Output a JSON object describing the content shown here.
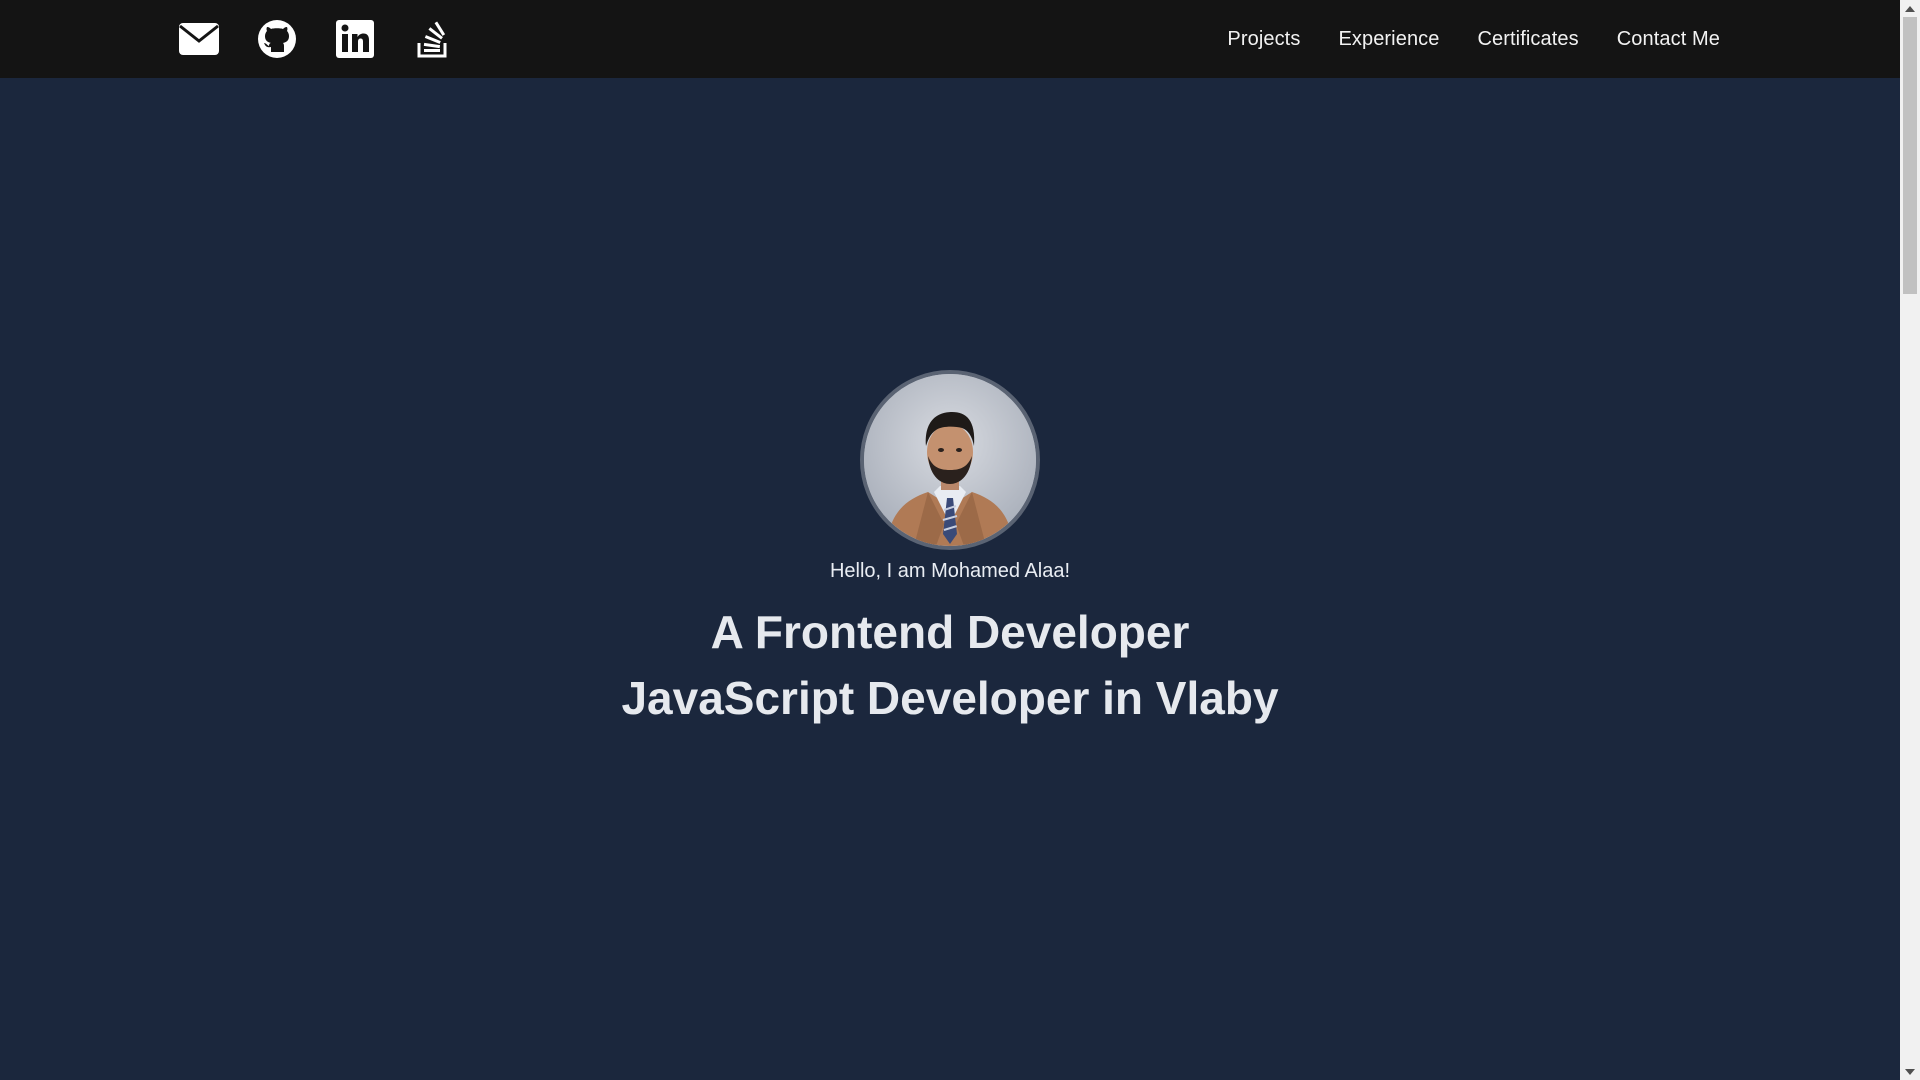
{
  "navbar": {
    "social_icons": [
      "envelope-icon",
      "github-icon",
      "linkedin-icon",
      "stackoverflow-icon"
    ],
    "links": [
      "Projects",
      "Experience",
      "Certificates",
      "Contact Me"
    ]
  },
  "hero": {
    "greeting": "Hello, I am Mohamed Alaa!",
    "title_line_1": "A Frontend Developer",
    "title_line_2": "JavaScript Developer in Vlaby"
  },
  "colors": {
    "page_background": "#1b273d",
    "navbar_background": "#141414",
    "text": "#e6e9ee"
  }
}
